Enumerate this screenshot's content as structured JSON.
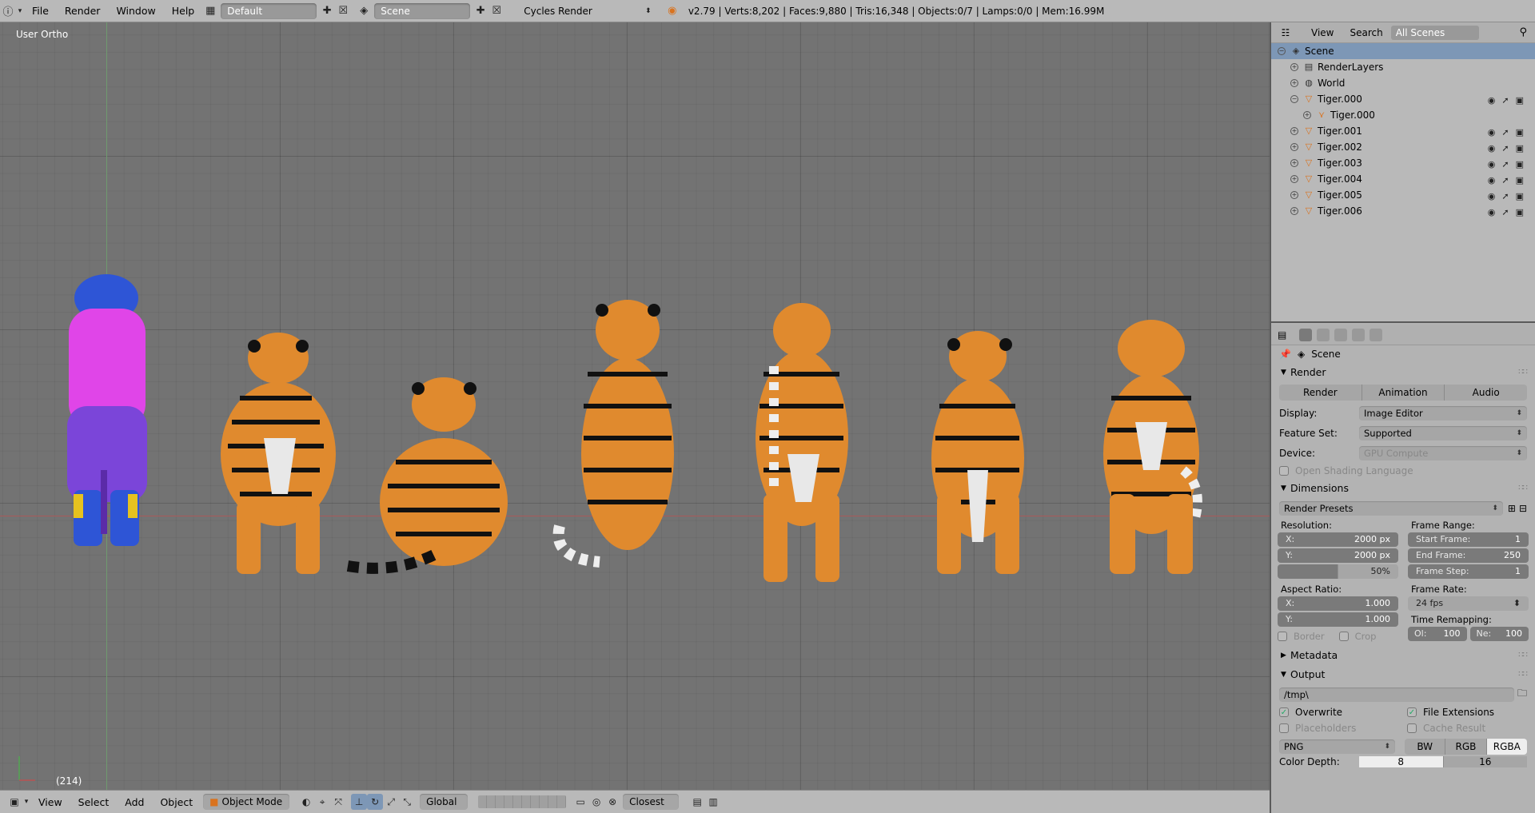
{
  "topbar": {
    "info_icon": "info-icon",
    "menus": [
      "File",
      "Render",
      "Window",
      "Help"
    ],
    "layout_value": "Default",
    "scene_value": "Scene",
    "engine_value": "Cycles Render",
    "stats": "v2.79 | Verts:8,202 | Faces:9,880 | Tris:16,348 | Objects:0/7 | Lamps:0/0 | Mem:16.99M"
  },
  "viewport": {
    "view_label": "User Ortho",
    "frame_number": "(214)"
  },
  "bottombar": {
    "menus": [
      "View",
      "Select",
      "Add",
      "Object"
    ],
    "mode": "Object Mode",
    "orientation": "Global",
    "snap_target": "Closest"
  },
  "outliner": {
    "menus": [
      "View",
      "Search"
    ],
    "display_mode": "All Scenes",
    "items": [
      {
        "label": "Scene",
        "depth": 0,
        "selected": true
      },
      {
        "label": "RenderLayers",
        "depth": 1
      },
      {
        "label": "World",
        "depth": 1
      },
      {
        "label": "Tiger.000",
        "depth": 1
      },
      {
        "label": "Tiger.000",
        "depth": 2
      },
      {
        "label": "Tiger.001",
        "depth": 1
      },
      {
        "label": "Tiger.002",
        "depth": 1
      },
      {
        "label": "Tiger.003",
        "depth": 1
      },
      {
        "label": "Tiger.004",
        "depth": 1
      },
      {
        "label": "Tiger.005",
        "depth": 1
      },
      {
        "label": "Tiger.006",
        "depth": 1
      }
    ]
  },
  "properties": {
    "context": "Scene",
    "render_panel": {
      "title": "Render",
      "buttons": [
        "Render",
        "Animation",
        "Audio"
      ],
      "display_label": "Display:",
      "display_value": "Image Editor",
      "feature_label": "Feature Set:",
      "feature_value": "Supported",
      "device_label": "Device:",
      "device_value": "GPU Compute",
      "osl_label": "Open Shading Language"
    },
    "dimensions_panel": {
      "title": "Dimensions",
      "presets": "Render Presets",
      "resolution_label": "Resolution:",
      "res_x_key": "X:",
      "res_x": "2000 px",
      "res_y_key": "Y:",
      "res_y": "2000 px",
      "res_pct": "50%",
      "frame_range_label": "Frame Range:",
      "start_key": "Start Frame:",
      "start": "1",
      "end_key": "End Frame:",
      "end": "250",
      "step_key": "Frame Step:",
      "step": "1",
      "aspect_label": "Aspect Ratio:",
      "aspect_x_key": "X:",
      "aspect_x": "1.000",
      "aspect_y_key": "Y:",
      "aspect_y": "1.000",
      "frame_rate_label": "Frame Rate:",
      "frame_rate": "24 fps",
      "time_remap_label": "Time Remapping:",
      "old_key": "Ol:",
      "old": "100",
      "new_key": "Ne:",
      "new": "100",
      "border_label": "Border",
      "crop_label": "Crop"
    },
    "metadata_panel": {
      "title": "Metadata"
    },
    "output_panel": {
      "title": "Output",
      "path": "/tmp\\",
      "overwrite": "Overwrite",
      "file_ext": "File Extensions",
      "placeholders": "Placeholders",
      "cache_result": "Cache Result",
      "format": "PNG",
      "color_modes": [
        "BW",
        "RGB",
        "RGBA"
      ],
      "color_depth_label": "Color Depth:",
      "depths": [
        "8",
        "16"
      ]
    }
  }
}
